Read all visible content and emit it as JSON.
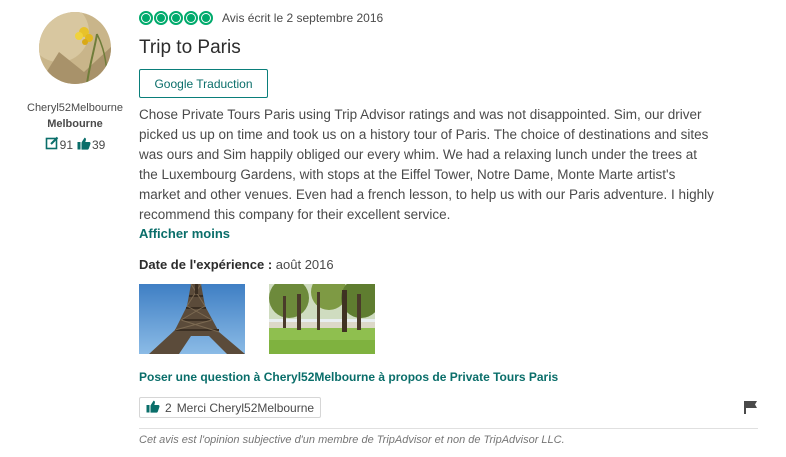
{
  "reviewer": {
    "username": "Cheryl52Melbourne",
    "location": "Melbourne",
    "contributions": "91",
    "helpful_votes": "39"
  },
  "review": {
    "rating": 5,
    "date_text": "Avis écrit le 2 septembre 2016",
    "title": "Trip to Paris",
    "translate_label": "Google Traduction",
    "body": "Chose Private Tours Paris using Trip Advisor ratings and was not disappointed. Sim, our driver picked us up on time and took us on a history tour of Paris. The choice of destinations and sites was ours and Sim happily obliged our every whim. We had a relaxing lunch under the trees at the Luxembourg Gardens, with stops at the Eiffel Tower, Notre Dame, Monte Marte artist's market and other venues. Even had a french lesson, to help us with our Paris adventure. I highly recommend this company for their excellent service.",
    "show_less_label": "Afficher moins",
    "experience_label": "Date de l'expérience :",
    "experience_value": "août 2016"
  },
  "actions": {
    "ask_question": "Poser une question à Cheryl52Melbourne à propos de Private Tours Paris",
    "thanks_count": "2",
    "thanks_label": "Merci Cheryl52Melbourne"
  },
  "footer": {
    "disclaimer": "Cet avis est l'opinion subjective d'un membre de TripAdvisor et non de TripAdvisor LLC."
  },
  "icons": {
    "rating": "bubble-rating-icon",
    "contributions": "review-count-icon",
    "helpful": "thumbs-up-icon",
    "report": "flag-icon"
  },
  "colors": {
    "accent": "#00aa6c",
    "link": "#0a6e6a"
  }
}
